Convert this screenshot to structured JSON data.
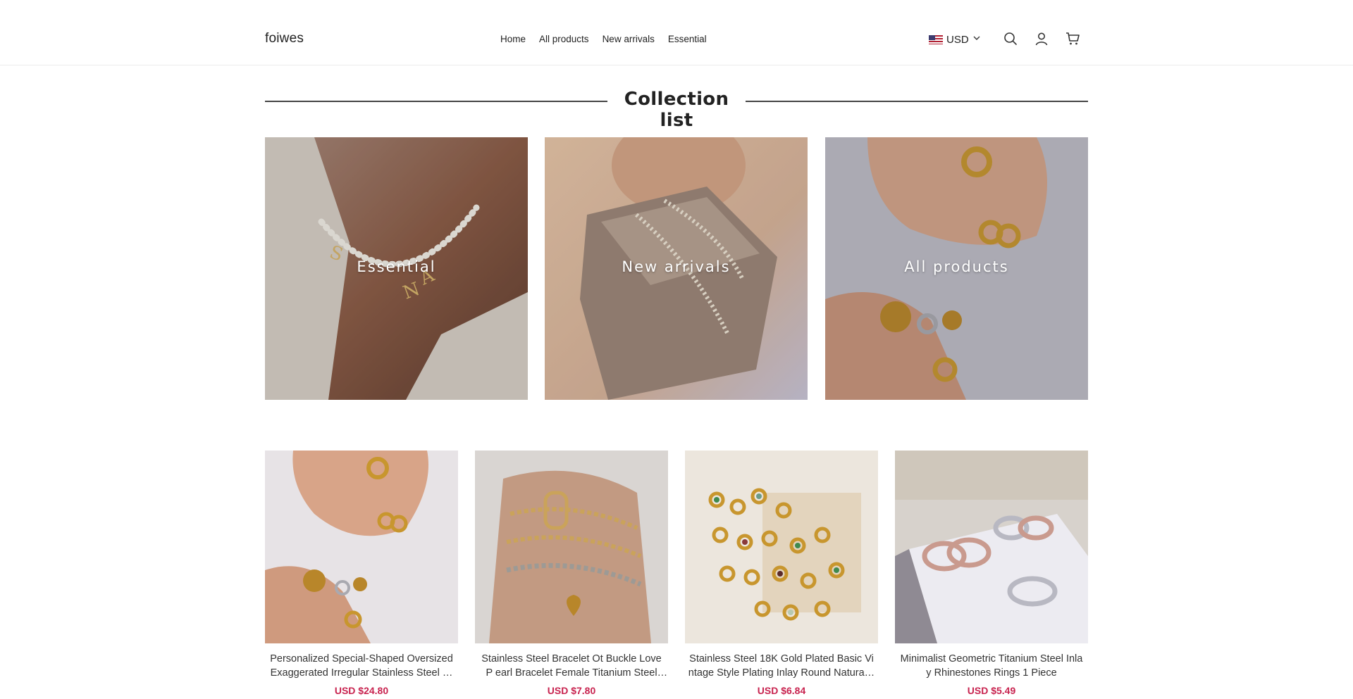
{
  "header": {
    "logo": "foiwes",
    "nav": [
      "Home",
      "All products",
      "New arrivals",
      "Essential"
    ],
    "currency": "USD"
  },
  "section": {
    "title": "Collection list"
  },
  "collections": [
    {
      "label": "Essential"
    },
    {
      "label": "New arrivals"
    },
    {
      "label": "All products"
    }
  ],
  "products": [
    {
      "title": "Personalized Special-Shaped Oversized Exaggerated Irregular Stainless Steel …",
      "price": "USD $24.80"
    },
    {
      "title": "Stainless Steel Bracelet Ot Buckle Love P earl Bracelet Female Titanium Steel Je…",
      "price": "USD $7.80"
    },
    {
      "title": "Stainless Steel 18K Gold Plated Basic Vi ntage Style Plating Inlay Round Natura…",
      "price": "USD $6.84"
    },
    {
      "title": "Minimalist Geometric Titanium Steel Inla y Rhinestones Rings 1 Piece",
      "price": "USD $5.49"
    }
  ],
  "colors": {
    "price": "#c8234f",
    "text": "#222222",
    "divider": "#444444"
  },
  "icons": [
    "search-icon",
    "account-icon",
    "cart-icon",
    "chevron-down-icon",
    "us-flag-icon"
  ]
}
